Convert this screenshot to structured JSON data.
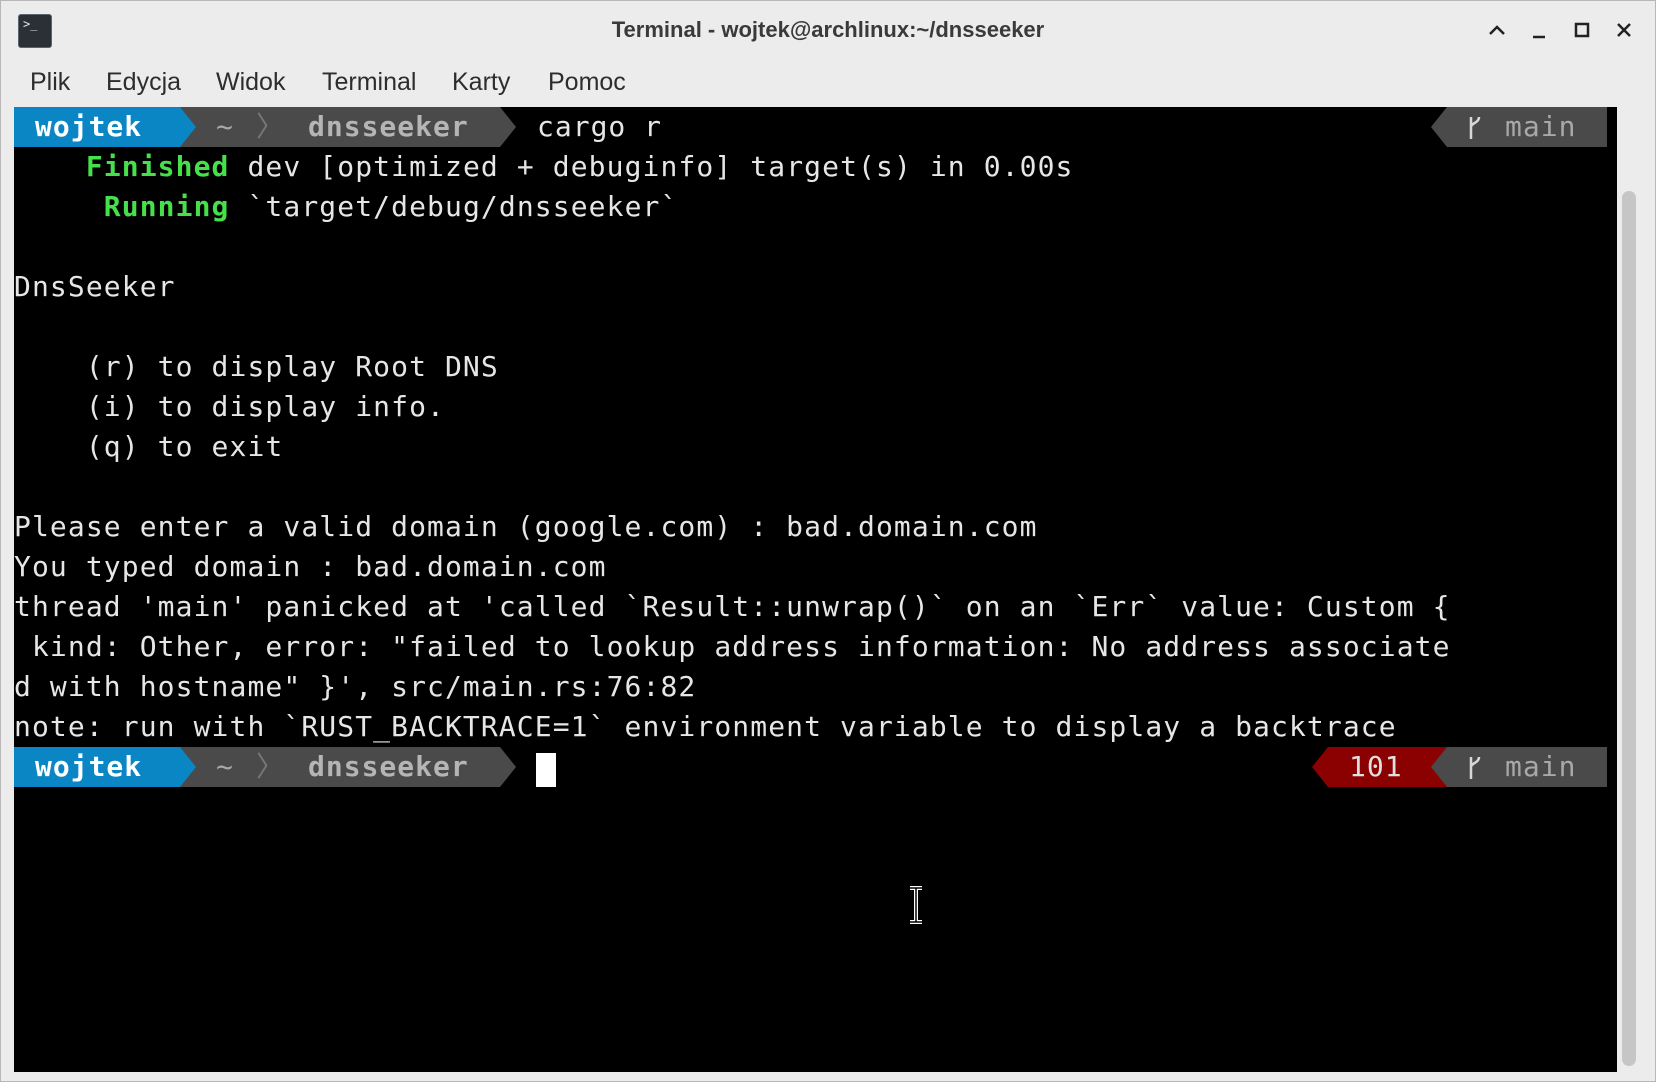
{
  "window": {
    "title": "Terminal - wojtek@archlinux:~/dnsseeker",
    "app_icon_glyph": ">_",
    "controls": {
      "maximize_up": "^",
      "minimize": "_",
      "restore": "☐",
      "close": "✕"
    }
  },
  "menu": {
    "items": [
      "Plik",
      "Edycja",
      "Widok",
      "Terminal",
      "Karty",
      "Pomoc"
    ]
  },
  "colors": {
    "prompt_user_bg": "#0a86c4",
    "prompt_path_bg": "#4a4a4a",
    "exit_code_bg": "#8b0000",
    "success_green": "#45e04a"
  },
  "terminal": {
    "prompt1": {
      "user": "wojtek",
      "home": "~",
      "separator": "〉",
      "dir": "dnsseeker",
      "command": "cargo r",
      "branch_icon": "git-branch-icon",
      "branch": "main"
    },
    "output": {
      "finished_label": "Finished",
      "finished_rest": " dev [optimized + debuginfo] target(s) in 0.00s",
      "running_label": "Running",
      "running_rest": " `target/debug/dnsseeker`",
      "app_name": "DnsSeeker",
      "menu_r": "    (r) to display Root DNS",
      "menu_i": "    (i) to display info.",
      "menu_q": "    (q) to exit",
      "ask": "Please enter a valid domain (google.com) : bad.domain.com",
      "typed": "You typed domain : bad.domain.com",
      "panic1": "thread 'main' panicked at 'called `Result::unwrap()` on an `Err` value: Custom {",
      "panic2": " kind: Other, error: \"failed to lookup address information: No address associate",
      "panic3": "d with hostname\" }', src/main.rs:76:82",
      "note": "note: run with `RUST_BACKTRACE=1` environment variable to display a backtrace"
    },
    "prompt2": {
      "user": "wojtek",
      "home": "~",
      "separator": "〉",
      "dir": "dnsseeker",
      "exit_code": "101",
      "branch_icon": "git-branch-icon",
      "branch": "main"
    }
  }
}
